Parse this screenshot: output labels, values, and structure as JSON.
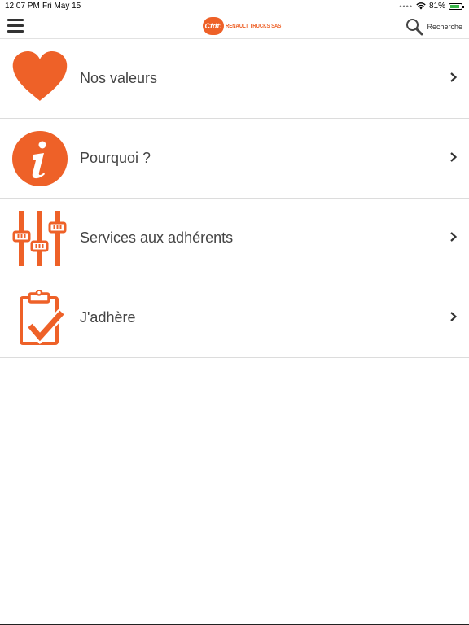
{
  "status": {
    "time": "12:07 PM",
    "date": "Fri May 15",
    "battery": "81%",
    "battery_level": 0.81,
    "signal_icon": "signal-dots-icon",
    "wifi_icon": "wifi-icon"
  },
  "header": {
    "logo_badge": "Cfdt:",
    "logo_text": "RENAULT TRUCKS SAS",
    "search_label": "Recherche",
    "menu_icon": "hamburger-icon",
    "search_icon": "search-icon"
  },
  "colors": {
    "accent": "#ee6128",
    "text": "#444444",
    "divider": "#dcdcdc"
  },
  "menu": [
    {
      "label": "Nos valeurs",
      "icon": "heart-icon"
    },
    {
      "label": "Pourquoi ?",
      "icon": "info-icon"
    },
    {
      "label": "Services aux adhérents",
      "icon": "sliders-icon"
    },
    {
      "label": "J'adhère",
      "icon": "clipboard-check-icon"
    }
  ]
}
